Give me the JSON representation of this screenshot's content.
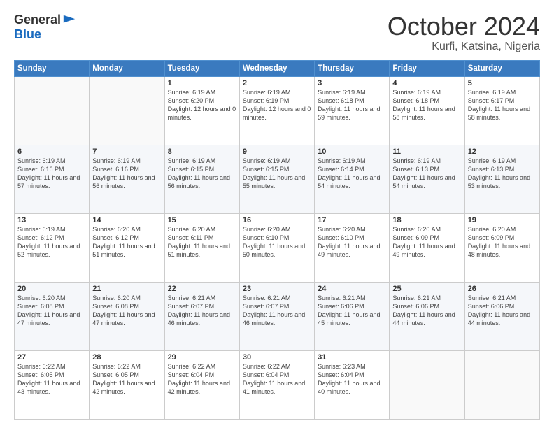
{
  "logo": {
    "general": "General",
    "blue": "Blue"
  },
  "title": "October 2024",
  "location": "Kurfi, Katsina, Nigeria",
  "days_header": [
    "Sunday",
    "Monday",
    "Tuesday",
    "Wednesday",
    "Thursday",
    "Friday",
    "Saturday"
  ],
  "weeks": [
    [
      {
        "num": "",
        "text": ""
      },
      {
        "num": "",
        "text": ""
      },
      {
        "num": "1",
        "text": "Sunrise: 6:19 AM\nSunset: 6:20 PM\nDaylight: 12 hours and 0 minutes."
      },
      {
        "num": "2",
        "text": "Sunrise: 6:19 AM\nSunset: 6:19 PM\nDaylight: 12 hours and 0 minutes."
      },
      {
        "num": "3",
        "text": "Sunrise: 6:19 AM\nSunset: 6:18 PM\nDaylight: 11 hours and 59 minutes."
      },
      {
        "num": "4",
        "text": "Sunrise: 6:19 AM\nSunset: 6:18 PM\nDaylight: 11 hours and 58 minutes."
      },
      {
        "num": "5",
        "text": "Sunrise: 6:19 AM\nSunset: 6:17 PM\nDaylight: 11 hours and 58 minutes."
      }
    ],
    [
      {
        "num": "6",
        "text": "Sunrise: 6:19 AM\nSunset: 6:16 PM\nDaylight: 11 hours and 57 minutes."
      },
      {
        "num": "7",
        "text": "Sunrise: 6:19 AM\nSunset: 6:16 PM\nDaylight: 11 hours and 56 minutes."
      },
      {
        "num": "8",
        "text": "Sunrise: 6:19 AM\nSunset: 6:15 PM\nDaylight: 11 hours and 56 minutes."
      },
      {
        "num": "9",
        "text": "Sunrise: 6:19 AM\nSunset: 6:15 PM\nDaylight: 11 hours and 55 minutes."
      },
      {
        "num": "10",
        "text": "Sunrise: 6:19 AM\nSunset: 6:14 PM\nDaylight: 11 hours and 54 minutes."
      },
      {
        "num": "11",
        "text": "Sunrise: 6:19 AM\nSunset: 6:13 PM\nDaylight: 11 hours and 54 minutes."
      },
      {
        "num": "12",
        "text": "Sunrise: 6:19 AM\nSunset: 6:13 PM\nDaylight: 11 hours and 53 minutes."
      }
    ],
    [
      {
        "num": "13",
        "text": "Sunrise: 6:19 AM\nSunset: 6:12 PM\nDaylight: 11 hours and 52 minutes."
      },
      {
        "num": "14",
        "text": "Sunrise: 6:20 AM\nSunset: 6:12 PM\nDaylight: 11 hours and 51 minutes."
      },
      {
        "num": "15",
        "text": "Sunrise: 6:20 AM\nSunset: 6:11 PM\nDaylight: 11 hours and 51 minutes."
      },
      {
        "num": "16",
        "text": "Sunrise: 6:20 AM\nSunset: 6:10 PM\nDaylight: 11 hours and 50 minutes."
      },
      {
        "num": "17",
        "text": "Sunrise: 6:20 AM\nSunset: 6:10 PM\nDaylight: 11 hours and 49 minutes."
      },
      {
        "num": "18",
        "text": "Sunrise: 6:20 AM\nSunset: 6:09 PM\nDaylight: 11 hours and 49 minutes."
      },
      {
        "num": "19",
        "text": "Sunrise: 6:20 AM\nSunset: 6:09 PM\nDaylight: 11 hours and 48 minutes."
      }
    ],
    [
      {
        "num": "20",
        "text": "Sunrise: 6:20 AM\nSunset: 6:08 PM\nDaylight: 11 hours and 47 minutes."
      },
      {
        "num": "21",
        "text": "Sunrise: 6:20 AM\nSunset: 6:08 PM\nDaylight: 11 hours and 47 minutes."
      },
      {
        "num": "22",
        "text": "Sunrise: 6:21 AM\nSunset: 6:07 PM\nDaylight: 11 hours and 46 minutes."
      },
      {
        "num": "23",
        "text": "Sunrise: 6:21 AM\nSunset: 6:07 PM\nDaylight: 11 hours and 46 minutes."
      },
      {
        "num": "24",
        "text": "Sunrise: 6:21 AM\nSunset: 6:06 PM\nDaylight: 11 hours and 45 minutes."
      },
      {
        "num": "25",
        "text": "Sunrise: 6:21 AM\nSunset: 6:06 PM\nDaylight: 11 hours and 44 minutes."
      },
      {
        "num": "26",
        "text": "Sunrise: 6:21 AM\nSunset: 6:06 PM\nDaylight: 11 hours and 44 minutes."
      }
    ],
    [
      {
        "num": "27",
        "text": "Sunrise: 6:22 AM\nSunset: 6:05 PM\nDaylight: 11 hours and 43 minutes."
      },
      {
        "num": "28",
        "text": "Sunrise: 6:22 AM\nSunset: 6:05 PM\nDaylight: 11 hours and 42 minutes."
      },
      {
        "num": "29",
        "text": "Sunrise: 6:22 AM\nSunset: 6:04 PM\nDaylight: 11 hours and 42 minutes."
      },
      {
        "num": "30",
        "text": "Sunrise: 6:22 AM\nSunset: 6:04 PM\nDaylight: 11 hours and 41 minutes."
      },
      {
        "num": "31",
        "text": "Sunrise: 6:23 AM\nSunset: 6:04 PM\nDaylight: 11 hours and 40 minutes."
      },
      {
        "num": "",
        "text": ""
      },
      {
        "num": "",
        "text": ""
      }
    ]
  ]
}
